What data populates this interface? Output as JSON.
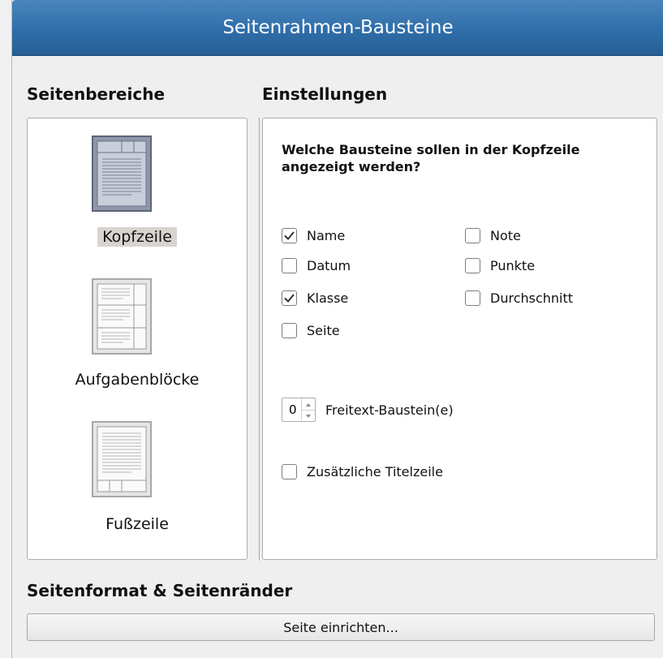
{
  "window": {
    "title": "Seitenrahmen-Bausteine"
  },
  "headings": {
    "areas": "Seitenbereiche",
    "settings": "Einstellungen",
    "page_format": "Seitenformat & Seitenränder"
  },
  "areas": {
    "selected": "Kopfzeile",
    "items": [
      {
        "label": "Kopfzeile",
        "icon": "page-header-icon",
        "selected": true
      },
      {
        "label": "Aufgabenblöcke",
        "icon": "page-blocks-icon",
        "selected": false
      },
      {
        "label": "Fußzeile",
        "icon": "page-footer-icon",
        "selected": false
      }
    ]
  },
  "settings": {
    "question": "Welche Bausteine sollen in der Kopfzeile angezeigt werden?",
    "checkboxes": [
      {
        "label": "Name",
        "checked": true
      },
      {
        "label": "Datum",
        "checked": false
      },
      {
        "label": "Klasse",
        "checked": true
      },
      {
        "label": "Seite",
        "checked": false
      },
      {
        "label": "Note",
        "checked": false
      },
      {
        "label": "Punkte",
        "checked": false
      },
      {
        "label": "Durchschnitt",
        "checked": false
      }
    ],
    "freetext": {
      "value": "0",
      "label": "Freitext-Baustein(e)"
    },
    "extra_title": {
      "label": "Zusätzliche Titelzeile",
      "checked": false
    }
  },
  "page_setup": {
    "button_label": "Seite einrichten..."
  },
  "colors": {
    "titlebar": "#2f6ea9",
    "selection": "#d8d4cf",
    "background": "#f0f0f0"
  }
}
